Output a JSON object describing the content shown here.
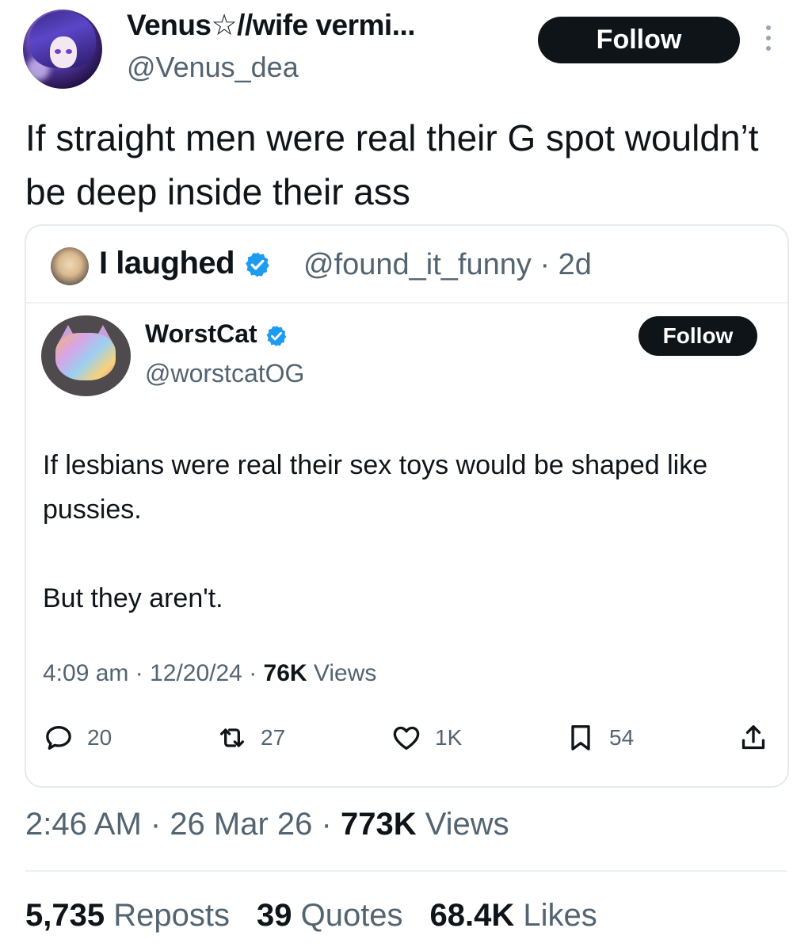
{
  "author": {
    "display_name": "Venus☆//wife vermi...",
    "handle": "@Venus_dea",
    "follow_label": "Follow"
  },
  "tweet": {
    "text": "If straight men were real their G spot wouldn’t be deep inside their ass",
    "time": "2:46 AM",
    "sep1": " · ",
    "date": "26 Mar 26",
    "sep2": " · ",
    "views_count": "773K",
    "views_label": " Views"
  },
  "quote": {
    "name": "I laughed",
    "handle": "@found_it_funny",
    "age": " · 2d",
    "inner": {
      "name": "WorstCat",
      "handle": "@worstcatOG",
      "follow_label": "Follow",
      "paragraph1": "If lesbians were real their sex toys would be shaped like pussies.",
      "paragraph2": "But they aren't.",
      "time": "4:09 am",
      "date": "12/20/24",
      "views_count": "76K",
      "views_label": " Views",
      "actions": {
        "replies": "20",
        "reposts": "27",
        "likes": "1K",
        "bookmarks": "54"
      }
    }
  },
  "stats": {
    "reposts_count": "5,735",
    "reposts_label": " Reposts",
    "quotes_count": "39",
    "quotes_label": " Quotes",
    "likes_count": "68.4K",
    "likes_label": " Likes"
  },
  "colors": {
    "verified": "#1d9bf0",
    "button_bg": "#0f1419",
    "secondary_text": "#536471"
  },
  "icons": [
    "more-icon",
    "verified-badge-icon",
    "reply-icon",
    "repost-icon",
    "like-icon",
    "bookmark-icon",
    "share-icon"
  ]
}
